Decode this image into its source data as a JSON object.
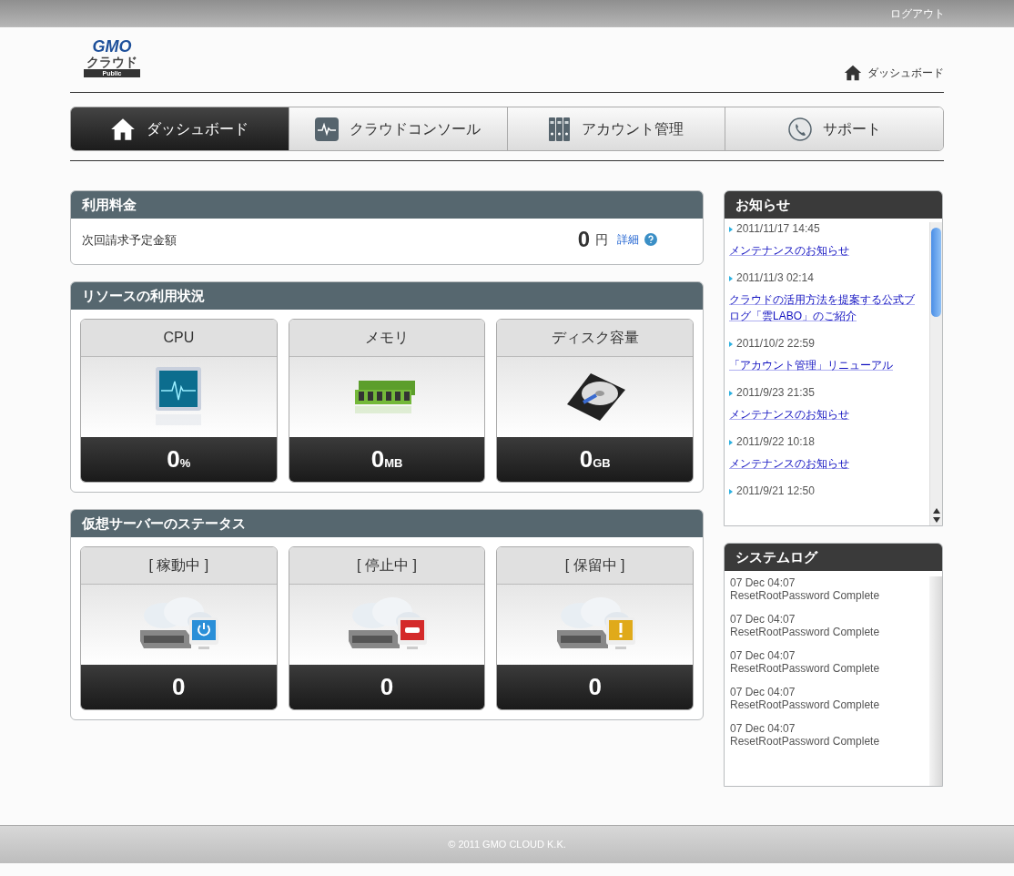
{
  "top_bar": {
    "logout": "ログアウト"
  },
  "logo": {
    "brand": "GMO",
    "product": "クラウド",
    "edition": "Public"
  },
  "breadcrumb": "ダッシュボード",
  "nav": [
    {
      "label": "ダッシュボード",
      "kind": "home",
      "selected": true
    },
    {
      "label": "クラウドコンソール",
      "kind": "console",
      "selected": false
    },
    {
      "label": "アカウント管理",
      "kind": "account",
      "selected": false
    },
    {
      "label": "サポート",
      "kind": "support",
      "selected": false
    }
  ],
  "billing": {
    "title": "利用料金",
    "label": "次回請求予定金額",
    "amount": "0",
    "currency": "円",
    "details_link": "詳細"
  },
  "resources": {
    "title": "リソースの利用状況",
    "cards": [
      {
        "label": "CPU",
        "kind": "cpu",
        "value": "0",
        "unit": "%"
      },
      {
        "label": "メモリ",
        "kind": "memory",
        "value": "0",
        "unit": "MB"
      },
      {
        "label": "ディスク容量",
        "kind": "disk",
        "value": "0",
        "unit": "GB"
      }
    ]
  },
  "server_status": {
    "title": "仮想サーバーのステータス",
    "cards": [
      {
        "label": "[ 稼動中 ]",
        "kind": "running",
        "value": "0"
      },
      {
        "label": "[ 停止中 ]",
        "kind": "stopped",
        "value": "0"
      },
      {
        "label": "[ 保留中 ]",
        "kind": "pending",
        "value": "0"
      }
    ]
  },
  "news": {
    "title": "お知らせ",
    "items": [
      {
        "date": "2011/11/17 14:45",
        "title": "メンテナンスのお知らせ"
      },
      {
        "date": "2011/11/3 02:14",
        "title": "クラウドの活用方法を提案する公式ブログ「雲LABO」のご紹介"
      },
      {
        "date": "2011/10/2 22:59",
        "title": "「アカウント管理」リニューアル"
      },
      {
        "date": "2011/9/23 21:35",
        "title": "メンテナンスのお知らせ"
      },
      {
        "date": "2011/9/22 10:18",
        "title": "メンテナンスのお知らせ"
      },
      {
        "date": "2011/9/21 12:50"
      }
    ]
  },
  "system_log": {
    "title": "システムログ",
    "entries": [
      {
        "time": "07 Dec 04:07",
        "message": "ResetRootPassword Complete"
      },
      {
        "time": "07 Dec 04:07",
        "message": "ResetRootPassword Complete"
      },
      {
        "time": "07 Dec 04:07",
        "message": "ResetRootPassword Complete"
      },
      {
        "time": "07 Dec 04:07",
        "message": "ResetRootPassword Complete"
      },
      {
        "time": "07 Dec 04:07",
        "message": "ResetRootPassword Complete"
      }
    ]
  },
  "footer": "© 2011 GMO CLOUD K.K."
}
